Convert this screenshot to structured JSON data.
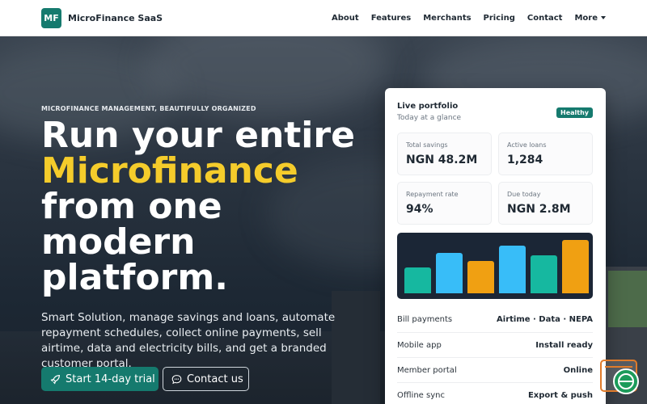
{
  "nav": {
    "brand_initials": "MF",
    "brand_name": "MicroFinance SaaS",
    "links": [
      "About",
      "Features",
      "Merchants",
      "Pricing",
      "Contact"
    ],
    "more_label": "More"
  },
  "hero": {
    "eyebrow": "MICROFINANCE MANAGEMENT, BEAUTIFULLY ORGANIZED",
    "headline_line1": "Run your entire",
    "headline_accent": "Microfinance",
    "headline_line3": "from one",
    "headline_line4": "modern",
    "headline_line5": "platform.",
    "lead": "Smart Solution, manage savings and loans, automate repayment schedules, collect online payments, sell airtime, data and electricity bills, and get a branded customer portal.",
    "cta_primary": "Start 14-day trial",
    "cta_secondary": "Contact us"
  },
  "portfolio": {
    "title": "Live portfolio",
    "subtitle": "Today at a glance",
    "status": "Healthy",
    "stats": [
      {
        "label": "Total savings",
        "value": "NGN 48.2M"
      },
      {
        "label": "Active loans",
        "value": "1,284"
      },
      {
        "label": "Repayment rate",
        "value": "94%"
      },
      {
        "label": "Due today",
        "value": "NGN 2.8M"
      }
    ],
    "rows": [
      {
        "label": "Bill payments",
        "value": "Airtime · Data · NEPA"
      },
      {
        "label": "Mobile app",
        "value": "Install ready"
      },
      {
        "label": "Member portal",
        "value": "Online"
      },
      {
        "label": "Offline sync",
        "value": "Export & push"
      }
    ]
  },
  "chart_data": {
    "type": "bar",
    "values": [
      0.45,
      0.69,
      0.56,
      0.82,
      0.65,
      0.91
    ],
    "colors": [
      "#16b8a0",
      "#38bdf8",
      "#f0a012",
      "#38bdf8",
      "#16b8a0",
      "#f0a012"
    ]
  },
  "colors": {
    "brand": "#157a6e",
    "accent": "#f5cc2b"
  }
}
